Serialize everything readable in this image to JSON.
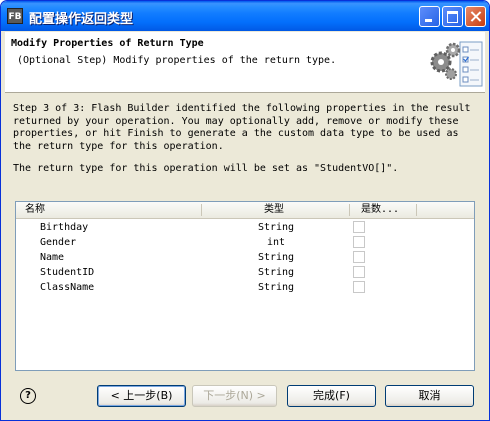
{
  "window": {
    "title": "配置操作返回类型",
    "app_icon": "FB"
  },
  "banner": {
    "title": "Modify Properties of Return Type",
    "description": "(Optional Step) Modify properties of the return type.",
    "graphic_icon": "gears-checklist-icon"
  },
  "message": {
    "lines": [
      "Step 3 of 3: Flash Builder identified the following properties in the result",
      "returned by your operation. You may optionally add, remove or modify these",
      "properties, or hit Finish to generate a the custom data type to be used as",
      "the return type for this operation."
    ],
    "return_type_note": "The return type for this operation will be set as \"StudentVO[]\"."
  },
  "table": {
    "columns": [
      "名称",
      "类型",
      "是数..."
    ],
    "rows": [
      {
        "name": "Birthday",
        "type": "String",
        "is_array": false
      },
      {
        "name": "Gender",
        "type": "int",
        "is_array": false
      },
      {
        "name": "Name",
        "type": "String",
        "is_array": false
      },
      {
        "name": "StudentID",
        "type": "String",
        "is_array": false
      },
      {
        "name": "ClassName",
        "type": "String",
        "is_array": false
      }
    ]
  },
  "buttons": {
    "back": "< 上一步(B)",
    "next": "下一步(N) >",
    "finish": "完成(F)",
    "cancel": "取消"
  },
  "help_glyph": "?"
}
